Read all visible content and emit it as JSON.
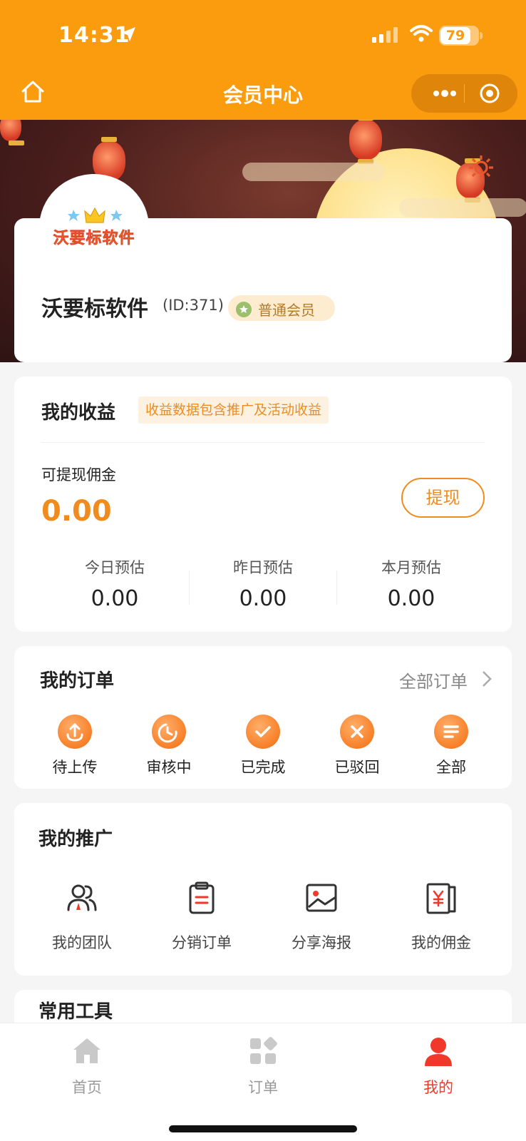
{
  "status_bar": {
    "time": "14:31",
    "battery": "79"
  },
  "nav": {
    "title": "会员中心"
  },
  "profile": {
    "avatar_logo_text": "沃要标软件",
    "name": "沃要标软件",
    "id_text": "(ID:371)",
    "member_level": "普通会员"
  },
  "earnings": {
    "title": "我的收益",
    "note": "收益数据包含推广及活动收益",
    "withdrawable_label": "可提现佣金",
    "withdrawable_value": "0.00",
    "withdraw_button": "提现",
    "estimates": [
      {
        "label": "今日预估",
        "value": "0.00"
      },
      {
        "label": "昨日预估",
        "value": "0.00"
      },
      {
        "label": "本月预估",
        "value": "0.00"
      }
    ]
  },
  "orders": {
    "title": "我的订单",
    "all_link": "全部订单",
    "items": [
      {
        "label": "待上传",
        "icon": "upload-icon"
      },
      {
        "label": "审核中",
        "icon": "clock-icon"
      },
      {
        "label": "已完成",
        "icon": "check-icon"
      },
      {
        "label": "已驳回",
        "icon": "close-icon"
      },
      {
        "label": "全部",
        "icon": "list-icon"
      }
    ]
  },
  "promotion": {
    "title": "我的推广",
    "items": [
      {
        "label": "我的团队",
        "icon": "team-icon"
      },
      {
        "label": "分销订单",
        "icon": "clipboard-icon"
      },
      {
        "label": "分享海报",
        "icon": "picture-icon"
      },
      {
        "label": "我的佣金",
        "icon": "commission-icon"
      }
    ]
  },
  "tools": {
    "title": "常用工具"
  },
  "tabbar": {
    "items": [
      {
        "label": "首页",
        "icon": "home-icon"
      },
      {
        "label": "订单",
        "icon": "orders-icon"
      },
      {
        "label": "我的",
        "icon": "user-icon",
        "active": true
      }
    ]
  },
  "colors": {
    "brand": "#fb9b0e",
    "accent": "#f08c1e",
    "active_tab": "#f0392b"
  }
}
